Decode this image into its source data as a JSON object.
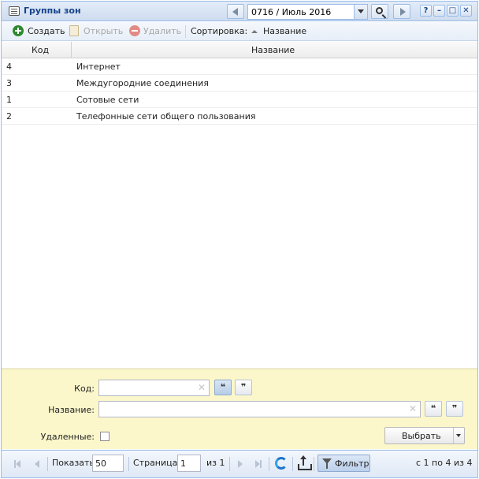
{
  "window": {
    "title": "Группы зон",
    "period": "0716 / Июль 2016",
    "help_label": "?",
    "minimize_label": "–",
    "maximize_label": "□",
    "close_label": "✕"
  },
  "toolbar": {
    "create_label": "Создать",
    "open_label": "Открыть",
    "delete_label": "Удалить",
    "sort_label": "Сортировка:",
    "sort_field": "Название"
  },
  "grid": {
    "columns": {
      "code": "Код",
      "name": "Название"
    },
    "rows": [
      {
        "code": "4",
        "name": "Интернет"
      },
      {
        "code": "3",
        "name": "Междугородние соединения"
      },
      {
        "code": "1",
        "name": "Сотовые сети"
      },
      {
        "code": "2",
        "name": "Телефонные сети общего пользования"
      }
    ]
  },
  "filter": {
    "code_label": "Код:",
    "code_value": "",
    "name_label": "Название:",
    "name_value": "",
    "clear_glyph": "✕",
    "quote_open": "❝",
    "quote_close": "❞",
    "deleted_label": "Удаленные:",
    "deleted_checked": false,
    "select_label": "Выбрать"
  },
  "paging": {
    "show_label": "Показать",
    "page_size": "50",
    "page_label": "Страница",
    "page_value": "1",
    "of_label": "из 1",
    "filter_label": "Фильтр",
    "summary": "с 1 по 4 из 4"
  },
  "icons": {
    "title": "window-icon",
    "create": "plus-circle-icon",
    "open": "open-document-icon",
    "delete": "minus-circle-icon",
    "search": "search-icon",
    "refresh": "refresh-icon",
    "export": "export-icon",
    "filter": "funnel-icon"
  }
}
